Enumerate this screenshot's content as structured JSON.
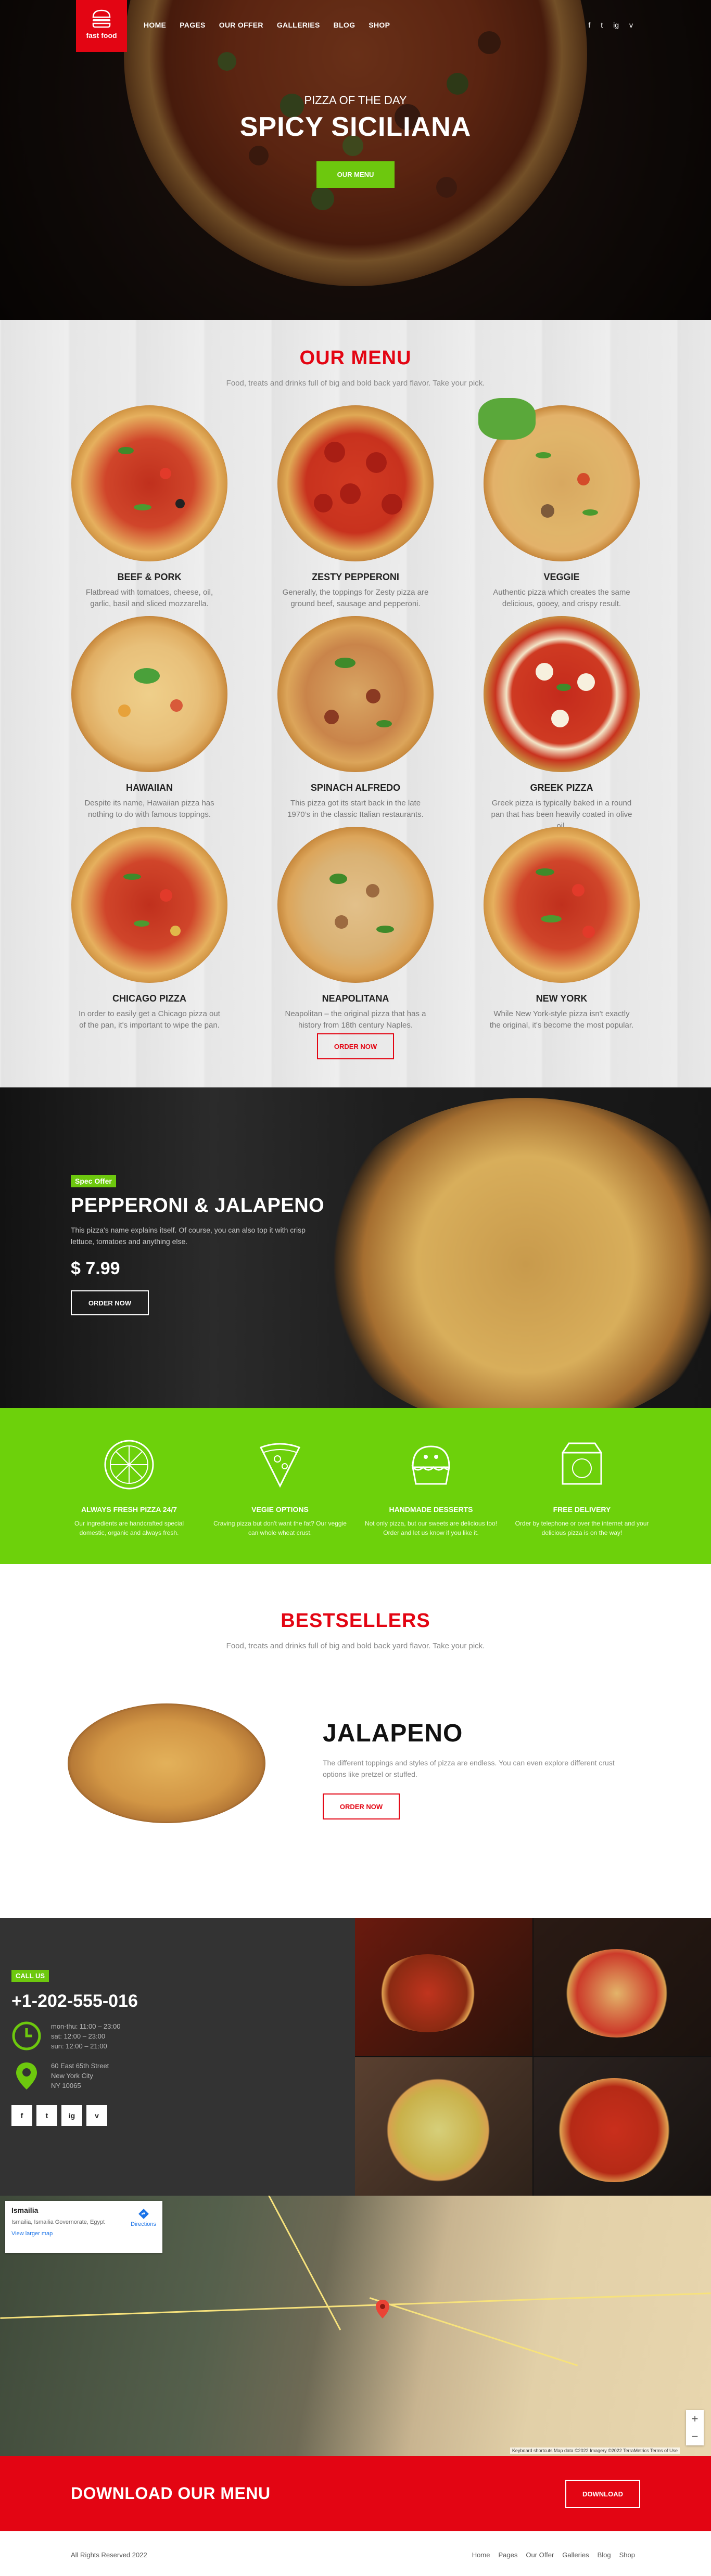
{
  "brand": {
    "name": "fast food"
  },
  "nav": {
    "items": [
      "HOME",
      "PAGES",
      "OUR OFFER",
      "GALLERIES",
      "BLOG",
      "SHOP"
    ],
    "social": [
      "f",
      "t",
      "ig",
      "v"
    ]
  },
  "hero": {
    "subtitle": "PIZZA OF THE DAY",
    "title": "SPICY SICILIANA",
    "button": "OUR MENU"
  },
  "menu": {
    "title": "OUR MENU",
    "subtitle": "Food, treats and drinks full of big and bold back yard flavor. Take your pick.",
    "items": [
      {
        "name": "BEEF & PORK",
        "desc": "Flatbread with tomatoes, cheese, oil, garlic, basil and sliced mozzarella."
      },
      {
        "name": "ZESTY PEPPERONI",
        "desc": "Generally, the toppings for Zesty pizza are ground beef, sausage and pepperoni."
      },
      {
        "name": "VEGGIE",
        "desc": "Authentic pizza which creates the same delicious, gooey, and crispy result."
      },
      {
        "name": "HAWAIIAN",
        "desc": "Despite its name, Hawaiian pizza has nothing to do with famous toppings."
      },
      {
        "name": "SPINACH ALFREDO",
        "desc": "This pizza got its start back in the late 1970’s in the classic Italian restaurants."
      },
      {
        "name": "GREEK PIZZA",
        "desc": "Greek pizza is typically baked in a round pan that has been heavily coated in olive oil."
      },
      {
        "name": "CHICAGO PIZZA",
        "desc": "In order to easily get a Chicago pizza out of the pan, it's important to wipe the pan."
      },
      {
        "name": "NEAPOLITANA",
        "desc": "Neapolitan – the original pizza that has a history from 18th century Naples."
      },
      {
        "name": "NEW YORK",
        "desc": "While New York-style pizza isn't exactly the original, it's become the most popular."
      }
    ],
    "button": "ORDER NOW"
  },
  "spec": {
    "badge": "Spec Offer",
    "title": "PEPPERONI & JALAPENO",
    "desc": "This pizza's name explains itself. Of course, you can also top it with crisp lettuce, tomatoes and anything else.",
    "price": "$ 7.99",
    "button": "ORDER NOW"
  },
  "features": [
    {
      "title": "ALWAYS FRESH PIZZA 24/7",
      "desc": "Our ingredients are handcrafted special domestic, organic and always fresh."
    },
    {
      "title": "VEGIE OPTIONS",
      "desc": "Craving pizza but don't want the fat? Our veggie can whole wheat crust."
    },
    {
      "title": "HANDMADE DESSERTS",
      "desc": "Not only pizza, but our sweets are delicious too! Order and let us know if you like it."
    },
    {
      "title": "FREE DELIVERY",
      "desc": "Order by telephone or over the internet and your delicious pizza is on the way!"
    }
  ],
  "bestsellers": {
    "title": "BESTSELLERS",
    "subtitle": "Food, treats and drinks full of big and bold back yard flavor. Take your pick.",
    "name": "JALAPENO",
    "desc": "The different toppings and styles of pizza are endless. You can even explore different crust options like pretzel or stuffed.",
    "button": "ORDER NOW"
  },
  "contact": {
    "badge": "CALL US",
    "phone": "+1-202-555-016",
    "hours": [
      "mon-thu: 11:00 – 23:00",
      "sat: 12:00 – 23:00",
      "sun: 12:00 – 21:00"
    ],
    "address": [
      "60 East 65th Street",
      "New York City",
      "NY 10065"
    ],
    "social": [
      "f",
      "t",
      "ig",
      "v"
    ]
  },
  "map": {
    "place": "Ismailia",
    "address": "Ismailia, Ismailia Governorate, Egypt",
    "larger": "View larger map",
    "directions": "Directions",
    "zoom_in": "+",
    "zoom_out": "−",
    "attribution": "Keyboard shortcuts   Map data ©2022 Imagery ©2022 TerraMetrics   Terms of Use"
  },
  "download": {
    "title": "DOWNLOAD OUR MENU",
    "button": "DOWNLOAD"
  },
  "footer": {
    "copyright": "All Rights Reserved 2022",
    "links": [
      "Home",
      "Pages",
      "Our Offer",
      "Galleries",
      "Blog",
      "Shop"
    ]
  },
  "colors": {
    "red": "#e30513",
    "green": "#6dc80e",
    "dark": "#333333"
  }
}
